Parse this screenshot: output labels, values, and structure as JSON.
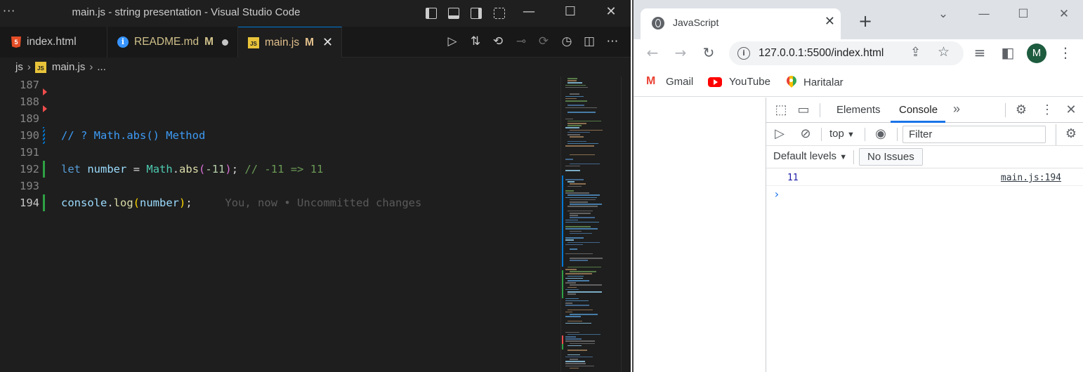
{
  "vscode": {
    "window_title": "main.js - string presentation - Visual Studio Code",
    "menu_glyph": "···",
    "tabs": [
      {
        "label": "index.html",
        "icon": "html5-icon"
      },
      {
        "label": "README.md",
        "icon": "info-icon",
        "status": "M"
      },
      {
        "label": "main.js",
        "icon": "js-icon",
        "status": "M",
        "active": true
      }
    ],
    "breadcrumb": {
      "folder": "js",
      "file": "main.js",
      "ellipsis": "..."
    },
    "lines": [
      {
        "n": "187"
      },
      {
        "n": "188"
      },
      {
        "n": "189"
      },
      {
        "n": "190",
        "comment": "// ? Math.abs() Method"
      },
      {
        "n": "191"
      },
      {
        "n": "192",
        "kw": "let",
        "var": "number",
        "op": "=",
        "obj": "Math",
        "fn": "abs",
        "arg": "-11",
        "comment": "// -11 => 11"
      },
      {
        "n": "193"
      },
      {
        "n": "194",
        "obj": "console",
        "fn": "log",
        "arg": "number",
        "blame": "You, now • Uncommitted changes"
      }
    ],
    "colors": {
      "background": "#1e1e1e",
      "comment": "#3d9bf5",
      "keyword": "#569cd6",
      "added": "#2ea043"
    }
  },
  "chrome": {
    "tab_title": "JavaScript",
    "url": "127.0.0.1:5500/index.html",
    "avatar_letter": "M",
    "bookmarks": [
      {
        "label": "Gmail",
        "icon": "gmail-icon"
      },
      {
        "label": "YouTube",
        "icon": "youtube-icon"
      },
      {
        "label": "Haritalar",
        "icon": "maps-icon"
      }
    ],
    "devtools": {
      "tabs": [
        "Elements",
        "Console"
      ],
      "context": "top",
      "filter_placeholder": "Filter",
      "levels": "Default levels",
      "issues": "No Issues",
      "console_output": {
        "value": "11",
        "source": "main.js:194"
      },
      "prompt": "›"
    }
  }
}
